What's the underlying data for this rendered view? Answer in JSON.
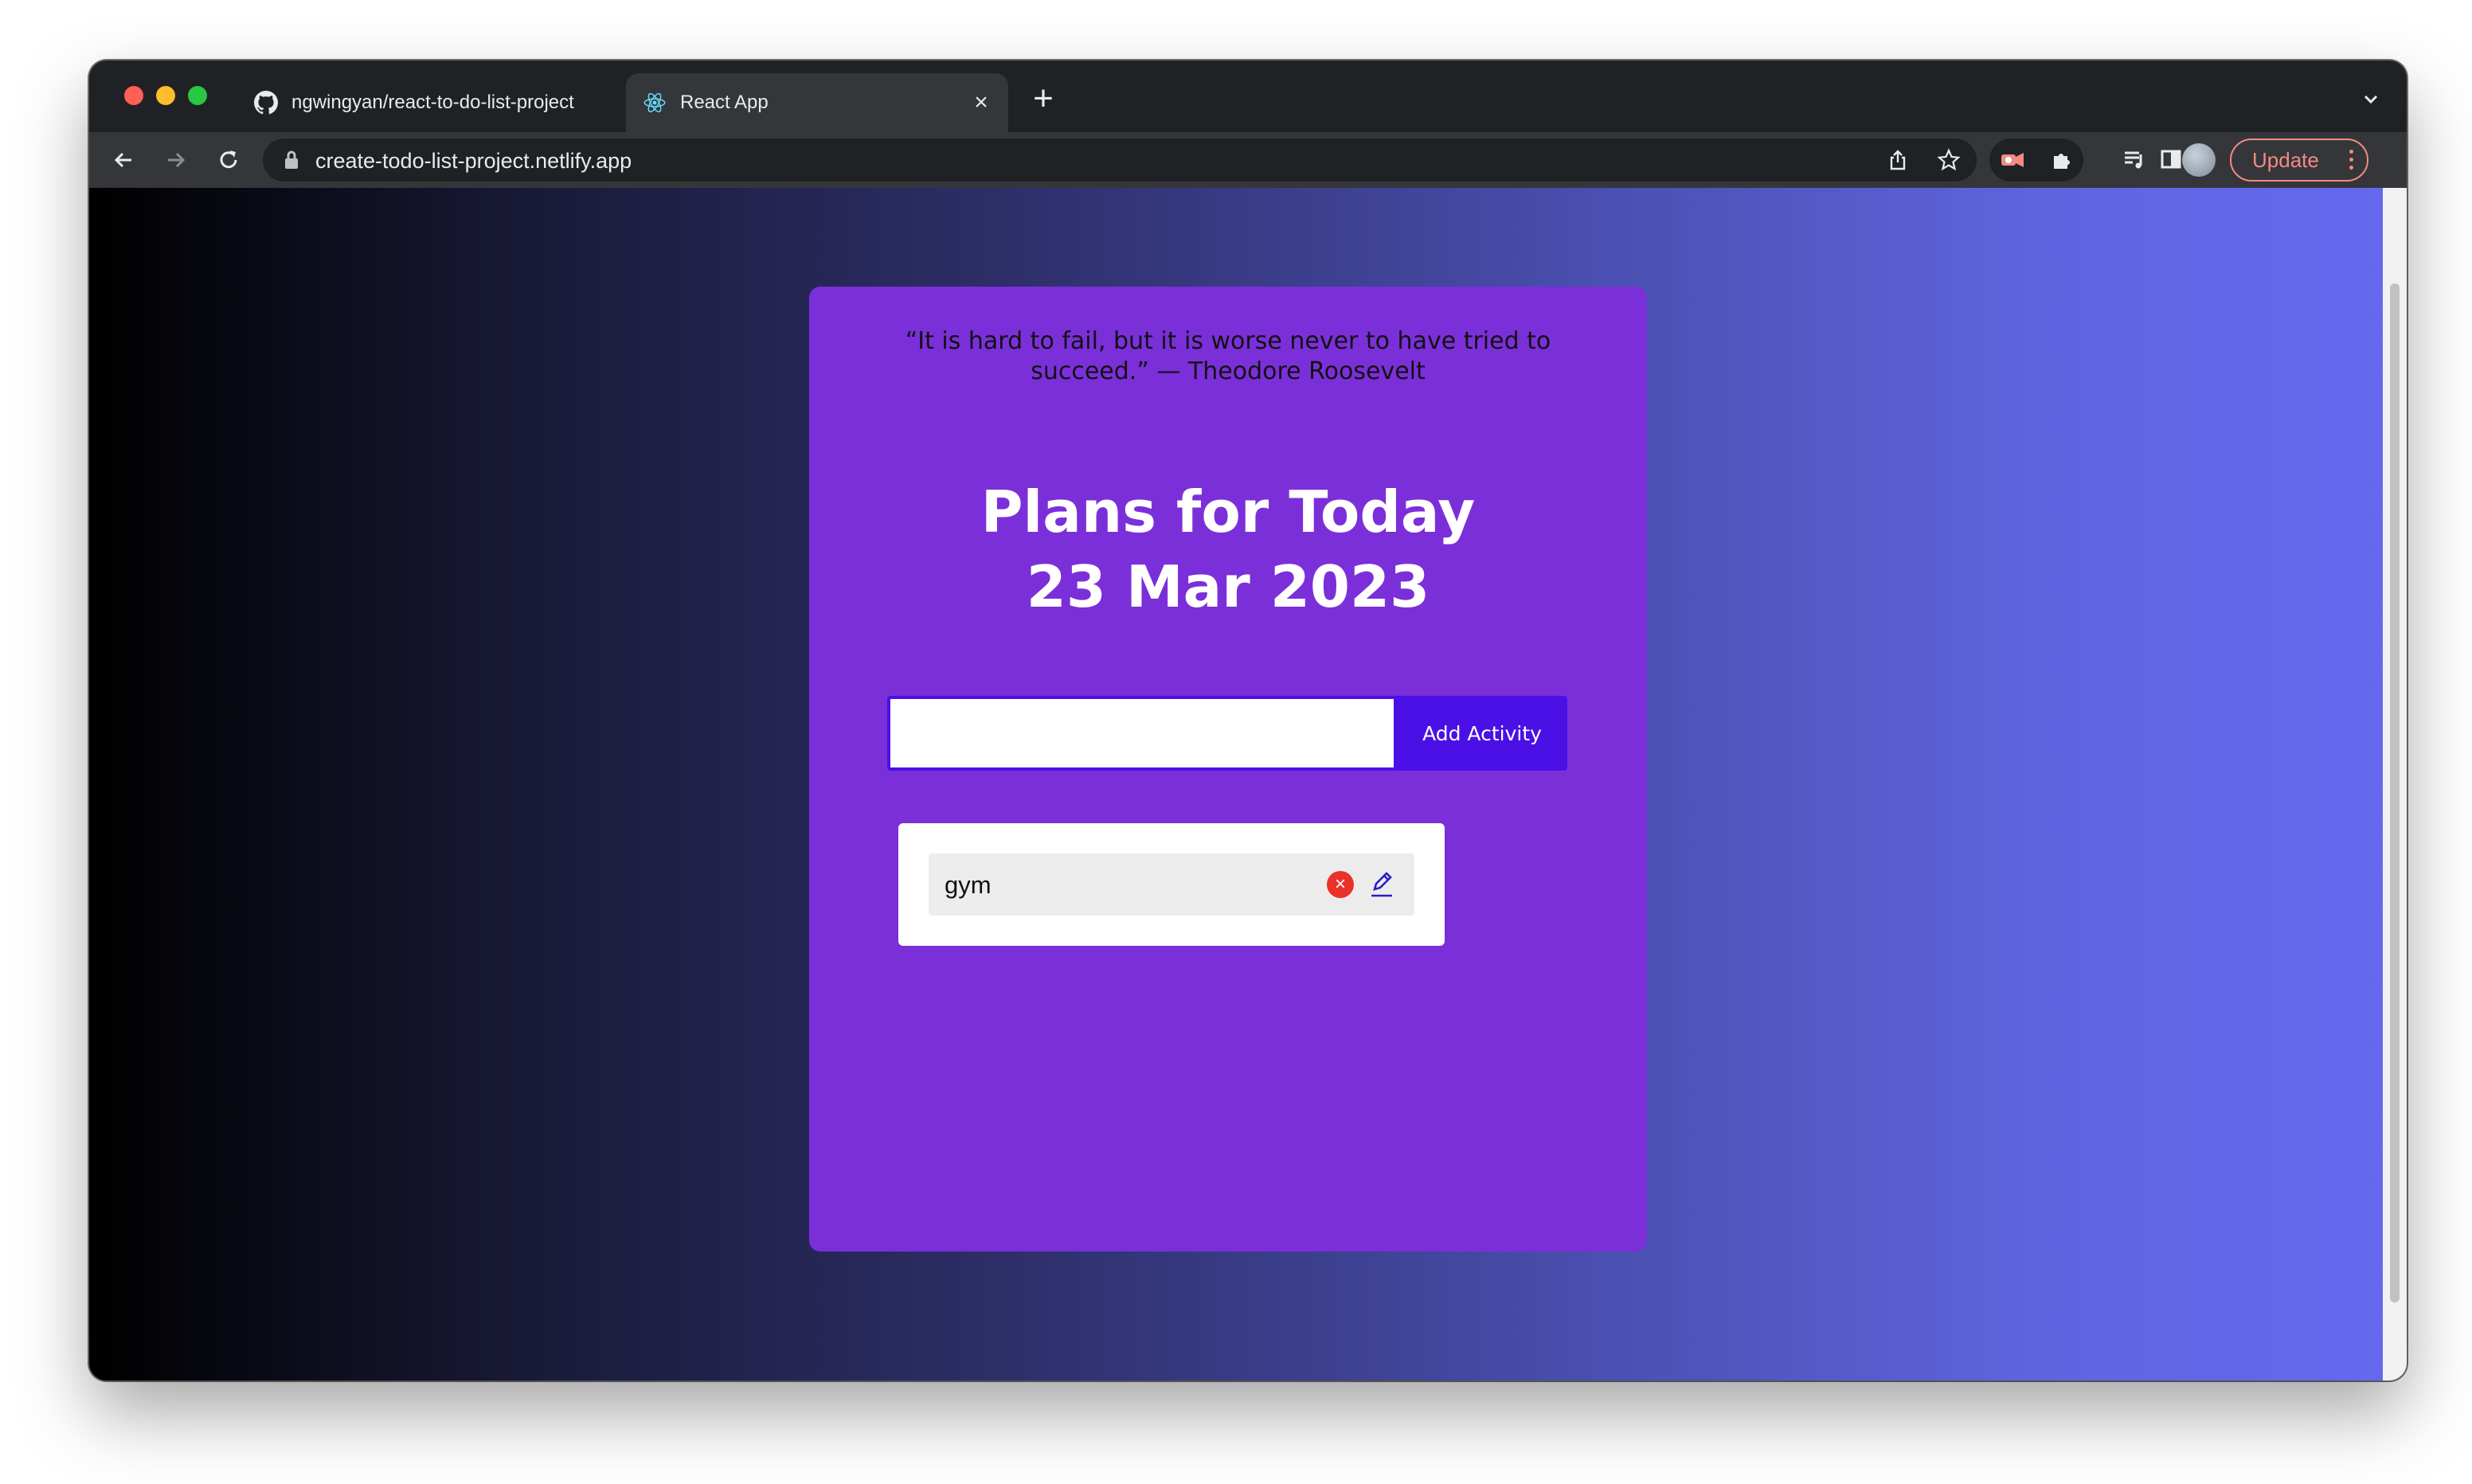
{
  "browser": {
    "tabs": [
      {
        "title": "ngwingyan/react-to-do-list-project",
        "favicon": "github-icon",
        "active": false
      },
      {
        "title": "React App",
        "favicon": "react-icon",
        "active": true
      }
    ],
    "new_tab": "+",
    "url": "create-todo-list-project.netlify.app",
    "update_label": "Update"
  },
  "app": {
    "quote_line1": "“It is hard to fail, but it is worse never to have tried to",
    "quote_line2": "succeed.” — Theodore Roosevelt",
    "heading_line1": "Plans for Today",
    "heading_line2": "23 Mar 2023",
    "input_value": "",
    "input_placeholder": "",
    "add_button_label": "Add Activity",
    "items": [
      {
        "text": "gym"
      }
    ]
  },
  "colors": {
    "card": "#7b2fd9",
    "accent_button": "#4a10e6",
    "delete_icon": "#e8322a",
    "update_outline": "#f28b82"
  }
}
